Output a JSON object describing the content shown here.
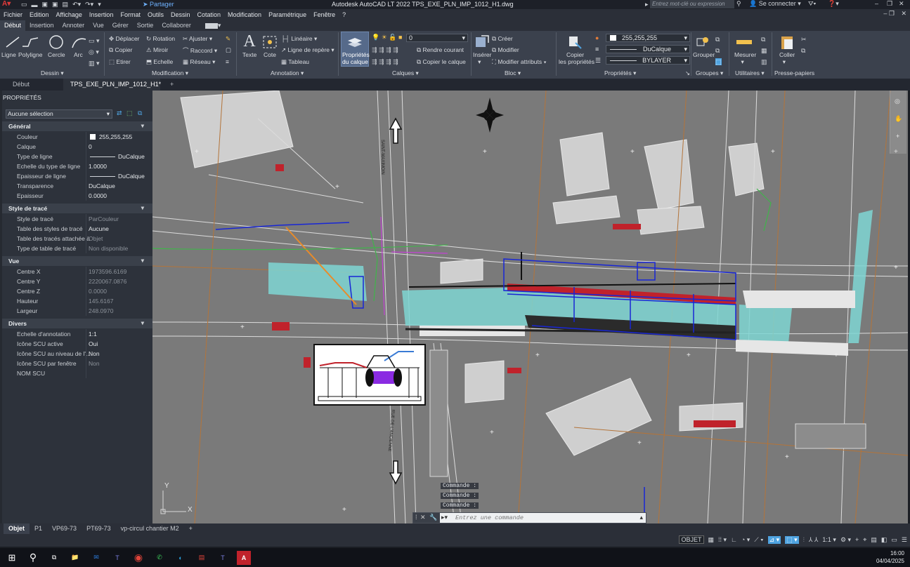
{
  "titlebar": {
    "share_label": "Partager",
    "title": "Autodesk AutoCAD LT 2022   TPS_EXE_PLN_IMP_1012_H1.dwg",
    "search_placeholder": "Entrez mot-clé ou expression",
    "signin_label": "Se connecter"
  },
  "menu": [
    "Fichier",
    "Edition",
    "Affichage",
    "Insertion",
    "Format",
    "Outils",
    "Dessin",
    "Cotation",
    "Modification",
    "Paramétrique",
    "Fenêtre",
    "?"
  ],
  "ribbon_tabs": [
    "Début",
    "Insertion",
    "Annoter",
    "Vue",
    "Gérer",
    "Sortie",
    "Collaborer"
  ],
  "ribbon": {
    "dessin": {
      "ligne": "Ligne",
      "polyligne": "Polyligne",
      "cercle": "Cercle",
      "arc": "Arc",
      "panel": "Dessin"
    },
    "modification": {
      "deplacer": "Déplacer",
      "rotation": "Rotation",
      "ajuster": "Ajuster",
      "copier": "Copier",
      "miroir": "Miroir",
      "raccord": "Raccord",
      "etirer": "Etirer",
      "echelle": "Echelle",
      "reseau": "Réseau",
      "panel": "Modification"
    },
    "annotation": {
      "texte": "Texte",
      "cote": "Cote",
      "lineaire": "Linéaire",
      "ligne_repere": "Ligne de repère",
      "tableau": "Tableau",
      "panel": "Annotation"
    },
    "calques": {
      "proprietes_l1": "Propriétés",
      "proprietes_l2": "du calque",
      "layer_value": "0",
      "rendre_courant": "Rendre courant",
      "copier_calque": "Copier le calque",
      "panel": "Calques"
    },
    "bloc": {
      "inserer": "Insérer",
      "creer": "Créer",
      "modifier": "Modifier",
      "modifier_attr": "Modifier attributs",
      "panel": "Bloc"
    },
    "proprietes": {
      "copier_l1": "Copier",
      "copier_l2": "les propriétés",
      "color": "255,255,255",
      "linetype": "DuCalque",
      "lineweight": "BYLAYER",
      "panel": "Propriétés"
    },
    "groupes": {
      "grouper": "Grouper",
      "panel": "Groupes"
    },
    "utilitaires": {
      "mesurer": "Mesurer",
      "panel": "Utilitaires"
    },
    "presse": {
      "coller": "Coller",
      "panel": "Presse-papiers"
    }
  },
  "doc_tabs": [
    "Début",
    "TPS_EXE_PLN_IMP_1012_H1*"
  ],
  "props": {
    "header": "PROPRIÉTÉS",
    "selection": "Aucune sélection",
    "sections": {
      "general": {
        "title": "Général",
        "rows": [
          {
            "k": "Couleur",
            "v": "255,255,255",
            "dim": false
          },
          {
            "k": "Calque",
            "v": "0",
            "dim": false
          },
          {
            "k": "Type de ligne",
            "v": "DuCalque",
            "dim": false
          },
          {
            "k": "Echelle du type de ligne",
            "v": "1.0000",
            "dim": false
          },
          {
            "k": "Epaisseur de ligne",
            "v": "DuCalque",
            "dim": false
          },
          {
            "k": "Transparence",
            "v": "DuCalque",
            "dim": false
          },
          {
            "k": "Epaisseur",
            "v": "0.0000",
            "dim": false
          }
        ]
      },
      "trace": {
        "title": "Style de tracé",
        "rows": [
          {
            "k": "Style de tracé",
            "v": "ParCouleur",
            "dim": true
          },
          {
            "k": "Table des styles de tracé",
            "v": "Aucune",
            "dim": false
          },
          {
            "k": "Table des tracés attachée à",
            "v": "Objet",
            "dim": true
          },
          {
            "k": "Type de table de tracé",
            "v": "Non disponible",
            "dim": true
          }
        ]
      },
      "vue": {
        "title": "Vue",
        "rows": [
          {
            "k": "Centre X",
            "v": "1973596.6169",
            "dim": true
          },
          {
            "k": "Centre Y",
            "v": "2220067.0876",
            "dim": true
          },
          {
            "k": "Centre Z",
            "v": "0.0000",
            "dim": true
          },
          {
            "k": "Hauteur",
            "v": "145.6167",
            "dim": true
          },
          {
            "k": "Largeur",
            "v": "248.0970",
            "dim": true
          }
        ]
      },
      "divers": {
        "title": "Divers",
        "rows": [
          {
            "k": "Echelle d'annotation",
            "v": "1:1",
            "dim": false
          },
          {
            "k": "Icône SCU active",
            "v": "Oui",
            "dim": false
          },
          {
            "k": "Icône SCU au niveau de l'...",
            "v": "Non",
            "dim": false
          },
          {
            "k": "Icône SCU par fenêtre",
            "v": "Non",
            "dim": true
          },
          {
            "k": "NOM SCU",
            "v": "",
            "dim": false
          }
        ]
      }
    }
  },
  "canvas": {
    "ucs_y": "Y",
    "ucs_x": "X",
    "street_left": "SAINT-MAXIMOIN",
    "street_bottom": "RUE DE L'ANCIENNE",
    "commands": [
      "Commande :",
      "Commande :",
      "Commande :"
    ],
    "cmd_placeholder": "Entrez une commande"
  },
  "layout_tabs": [
    "Objet",
    "P1",
    "VP69-73",
    "PT69-73",
    "vp-circul chantier M2"
  ],
  "status": {
    "model": "OBJET",
    "scale": "1:1"
  },
  "taskbar": {
    "time": "16:00",
    "date": "04/04/2025"
  },
  "colors": {
    "accent": "#4fa3e0",
    "teal": "#7fd6d3",
    "road_blue": "#1826d6",
    "brown": "#b3743a"
  }
}
